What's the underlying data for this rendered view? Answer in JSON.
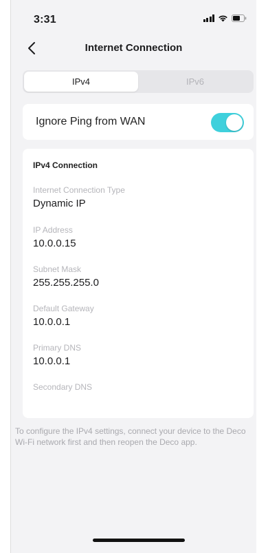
{
  "status_bar": {
    "time": "3:31",
    "icons": [
      "signal-icon",
      "wifi-icon",
      "battery-icon"
    ]
  },
  "header": {
    "title": "Internet Connection",
    "back_icon": "chevron-left-icon"
  },
  "tabs": [
    {
      "label": "IPv4",
      "active": true
    },
    {
      "label": "IPv6",
      "active": false
    }
  ],
  "ping_setting": {
    "label": "Ignore Ping from WAN",
    "enabled": true
  },
  "ipv4_connection": {
    "title": "IPv4 Connection",
    "fields": [
      {
        "label": "Internet Connection Type",
        "value": "Dynamic IP"
      },
      {
        "label": "IP Address",
        "value": "10.0.0.15"
      },
      {
        "label": "Subnet Mask",
        "value": "255.255.255.0"
      },
      {
        "label": "Default Gateway",
        "value": "10.0.0.1"
      },
      {
        "label": "Primary DNS",
        "value": "10.0.0.1"
      },
      {
        "label": "Secondary DNS",
        "value": ""
      }
    ]
  },
  "footnote": "To configure the IPv4 settings, connect your device to the Deco Wi-Fi network first and then reopen the Deco app.",
  "colors": {
    "accent": "#3fd0dc",
    "background": "#f3f3f5",
    "card": "#ffffff",
    "muted_text": "#b5b5ba"
  }
}
